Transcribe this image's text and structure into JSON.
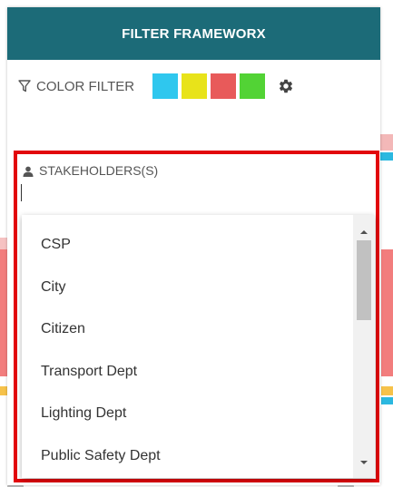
{
  "panel": {
    "title": "FILTER FRAMEWORX"
  },
  "color_filter": {
    "label": "COLOR FILTER",
    "swatches": [
      {
        "name": "cyan",
        "color": "#2fc7ee"
      },
      {
        "name": "yellow",
        "color": "#e8e31a"
      },
      {
        "name": "red",
        "color": "#e85a5a"
      },
      {
        "name": "green",
        "color": "#52d335"
      }
    ],
    "settings_icon": "gear-icon"
  },
  "stakeholders": {
    "label": "STAKEHOLDERS(S)",
    "input_value": ""
  },
  "dropdown": {
    "options": [
      "CSP",
      "City",
      "Citizen",
      "Transport Dept",
      "Lighting Dept",
      "Public Safety Dept"
    ]
  },
  "colors": {
    "header_bg": "#1c6b78",
    "highlight_border": "#e2060c"
  }
}
